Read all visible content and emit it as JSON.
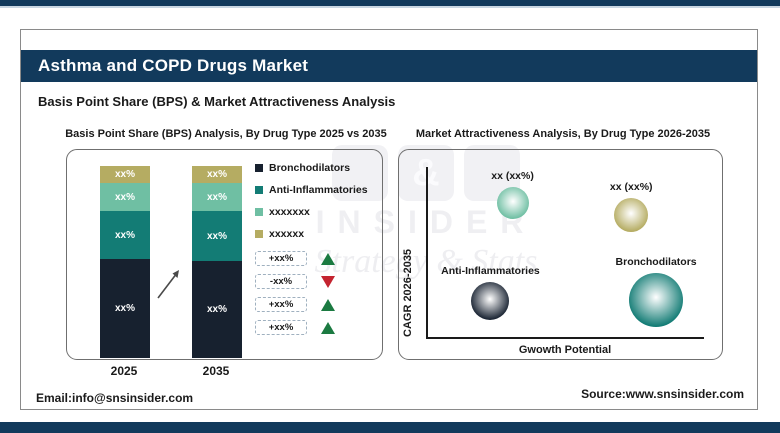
{
  "page": {
    "header": {
      "title": "Asthma and COPD Drugs Market",
      "subtitle": "Basis Point Share (BPS) & Market Attractiveness Analysis"
    },
    "footer": {
      "email": "Email:info@snsinsider.com",
      "source": "Source:www.snsinsider.com"
    },
    "watermark": {
      "symbol": "&",
      "name": "INSIDER",
      "tagline": "Strategy & Stats"
    }
  },
  "colors": {
    "navy_band": "#123a5c",
    "bar_dark": "#17212f",
    "teal": "#137c75",
    "seafoam": "#6fbfa3",
    "khaki": "#b5ac62",
    "up_green": "#1b7a41",
    "down_red": "#c42430"
  },
  "chart_data": [
    {
      "type": "bar",
      "stacked": true,
      "title": "Basis Point Share (BPS) Analysis, By Drug Type 2025 vs 2035",
      "categories": [
        "2025",
        "2035"
      ],
      "series": [
        {
          "name": "Bronchodilators",
          "color": "#17212f",
          "labels": [
            "xx%",
            "xx%"
          ],
          "heights_pct": [
            51.5,
            50.5
          ]
        },
        {
          "name": "Anti-Inflammatories",
          "color": "#137c75",
          "labels": [
            "xx%",
            "xx%"
          ],
          "heights_pct": [
            25.0,
            26.0
          ]
        },
        {
          "name": "xxxxxxx",
          "color": "#6fbfa3",
          "labels": [
            "xx%",
            "xx%"
          ],
          "heights_pct": [
            14.6,
            14.6
          ]
        },
        {
          "name": "xxxxxx",
          "color": "#b5ac62",
          "labels": [
            "xx%",
            "xx%"
          ],
          "heights_pct": [
            8.9,
            8.9
          ]
        }
      ],
      "change_indicators": [
        {
          "label": "+xx%",
          "direction": "up"
        },
        {
          "label": "-xx%",
          "direction": "down"
        },
        {
          "label": "+xx%",
          "direction": "up"
        },
        {
          "label": "+xx%",
          "direction": "up"
        }
      ]
    },
    {
      "type": "scatter",
      "title": "Market Attractiveness Analysis, By Drug Type 2026-2035",
      "xlabel": "Gwowth Potential",
      "ylabel": "CAGR 2026-2035",
      "x_range": [
        0,
        1
      ],
      "y_range": [
        0,
        1
      ],
      "points": [
        {
          "label": "xx (xx%)",
          "color": "#6fbfa3",
          "x": 0.31,
          "y": 0.79,
          "r": 16
        },
        {
          "label": "xx (xx%)",
          "color": "#b5ac62",
          "x": 0.74,
          "y": 0.72,
          "r": 17
        },
        {
          "label": "Anti-Inflammatories",
          "color": "#1a2433",
          "x": 0.23,
          "y": 0.21,
          "r": 19
        },
        {
          "label": "Bronchodilators",
          "color": "#137c75",
          "x": 0.83,
          "y": 0.22,
          "r": 27
        }
      ]
    }
  ]
}
